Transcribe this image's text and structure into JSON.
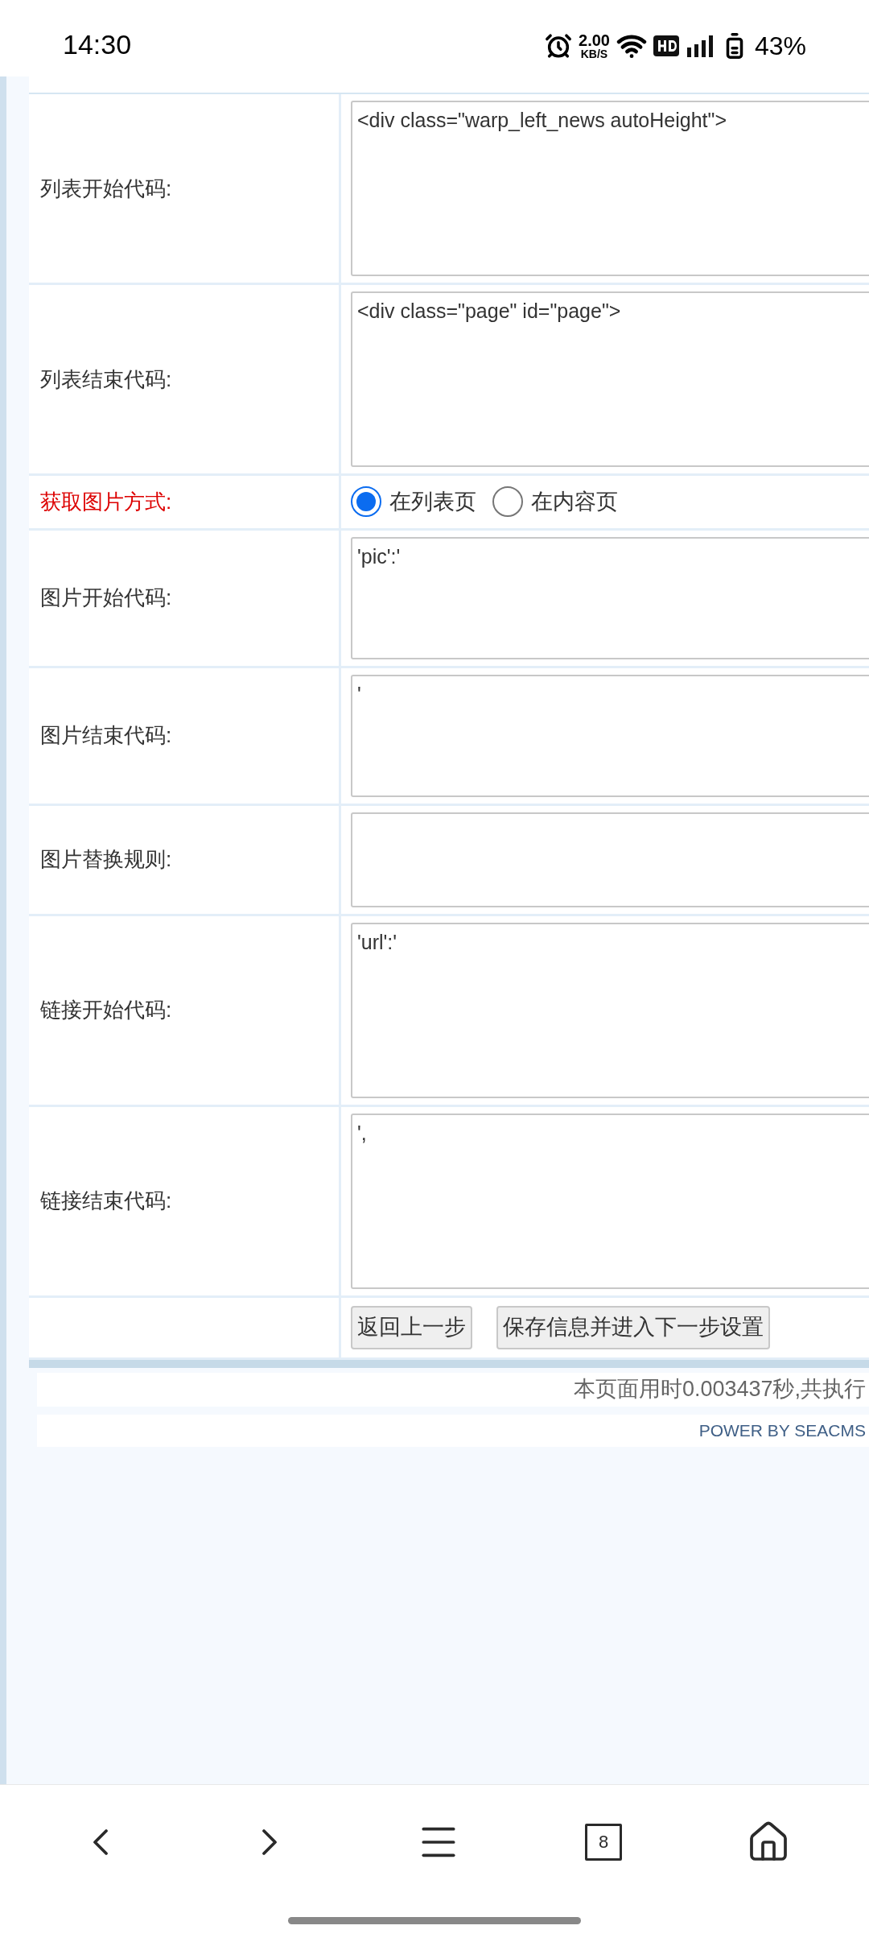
{
  "status_bar": {
    "time": "14:30",
    "speed_value": "2.00",
    "speed_unit": "KB/S",
    "battery": "43%"
  },
  "form": {
    "rows": [
      {
        "kind": "textarea",
        "label": "列表开始代码:",
        "value": "<div class=\"warp_left_news autoHeight\">",
        "highlight": false
      },
      {
        "kind": "textarea",
        "label": "列表结束代码:",
        "value": "<div class=\"page\" id=\"page\">",
        "highlight": false
      },
      {
        "kind": "radio",
        "label": "获取图片方式:",
        "highlight": true,
        "options": [
          {
            "label": "在列表页",
            "selected": true
          },
          {
            "label": "在内容页",
            "selected": false
          }
        ]
      },
      {
        "kind": "textarea",
        "label": "图片开始代码:",
        "value": "'pic':'",
        "highlight": false
      },
      {
        "kind": "textarea",
        "label": "图片结束代码:",
        "value": "'",
        "highlight": false
      },
      {
        "kind": "textarea",
        "label": "图片替换规则:",
        "highlight": false
      },
      {
        "kind": "textarea",
        "label": "链接开始代码:",
        "value": "'url':'",
        "highlight": false
      },
      {
        "kind": "textarea",
        "label": "链接结束代码:",
        "value": "',",
        "highlight": false
      }
    ],
    "buttons": [
      "返回上一步",
      "保存信息并进入下一步设置"
    ]
  },
  "footer": {
    "timing": "本页面用时0.003437秒,共执行",
    "power": "POWER BY SEACMS"
  },
  "browser_nav": {
    "tab_count": "8"
  }
}
